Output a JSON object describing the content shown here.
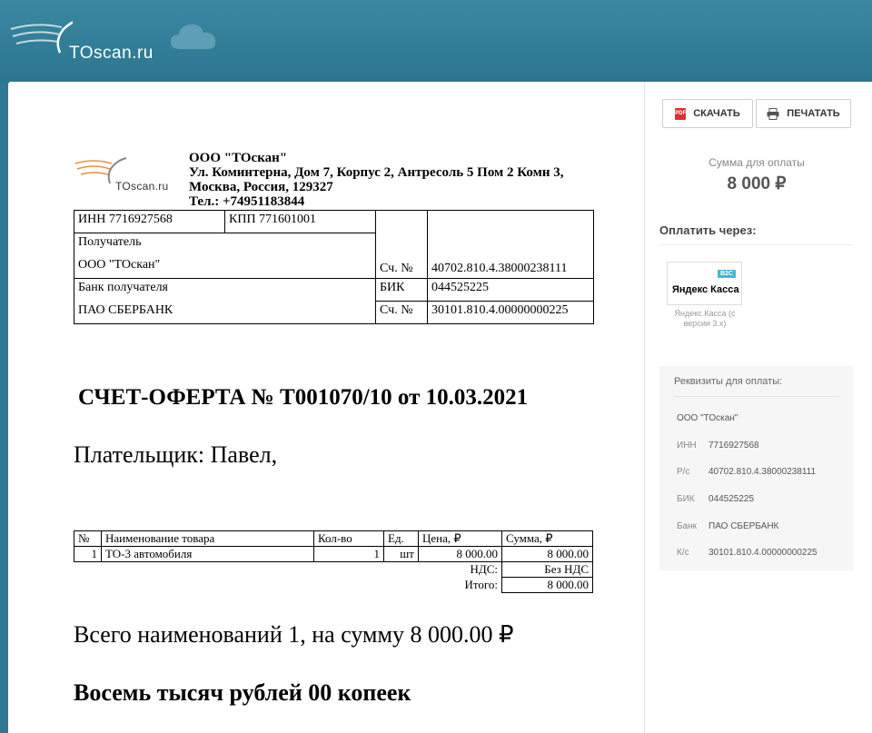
{
  "header": {
    "logo_text": "TOscan.ru"
  },
  "toolbar": {
    "download_label": "СКАЧАТЬ",
    "print_label": "ПЕЧАТАТЬ",
    "pdf_icon_text": "PDF"
  },
  "payment": {
    "sum_label": "Сумма для оплаты",
    "sum_value": "8 000 ₽",
    "pay_via_label": "Оплатить через:",
    "method_name": "Яндекс Касса",
    "method_badge": "B2C",
    "method_caption": "Яндекс.Касса (с версии 3.x)"
  },
  "requisites_panel": {
    "title": "Реквизиты для оплаты:",
    "rows": [
      {
        "key": "",
        "value": "ООО \"ТОскан\""
      },
      {
        "key": "ИНН",
        "value": "7716927568"
      },
      {
        "key": "Р/с",
        "value": "40702.810.4.38000238111"
      },
      {
        "key": "БИК",
        "value": "044525225"
      },
      {
        "key": "Банк",
        "value": "ПАО СБЕРБАНК"
      },
      {
        "key": "К/с",
        "value": "30101.810.4.00000000225"
      }
    ]
  },
  "invoice": {
    "logo_text": "TOscan.ru",
    "company_name": "ООО \"ТОскан\"",
    "company_address": "Ул. Коминтерна, Дом 7, Корпус 2, Антресоль 5 Пом 2 Комн 3, Москва, Россия, 129327",
    "company_phone": "Тел.: +74951183844",
    "inn": "ИНН 7716927568",
    "kpp": "КПП 771601001",
    "recipient_label": "Получатель",
    "recipient_name": "ООО \"ТОскан\"",
    "account_label": "Сч. №",
    "account_value": "40702.810.4.38000238111",
    "bank_label": "Банк получателя",
    "bank_name": "ПАО СБЕРБАНК",
    "bik_label": "БИК",
    "bik_value": "044525225",
    "corr_label": "Сч. №",
    "corr_value": "30101.810.4.00000000225",
    "title": "СЧЕТ-ОФЕРТА № Т001070/10 от 10.03.2021",
    "payer": "Плательщик: Павел,",
    "table_headers": [
      "№",
      "Наименование товара",
      "Кол-во",
      "Ед.",
      "Цена, ₽",
      "Сумма, ₽"
    ],
    "rows": [
      {
        "n": "1",
        "name": "ТО-3 автомобиля",
        "qty": "1",
        "unit": "шт",
        "price": "8 000.00",
        "sum": "8 000.00"
      }
    ],
    "vat_label": "НДС:",
    "vat_value": "Без НДС",
    "total_label": "Итого:",
    "total_value": "8 000.00",
    "total_words": "Всего наименований 1, на сумму 8 000.00 ₽",
    "total_caps": "Восемь тысяч рублей 00 копеек"
  }
}
